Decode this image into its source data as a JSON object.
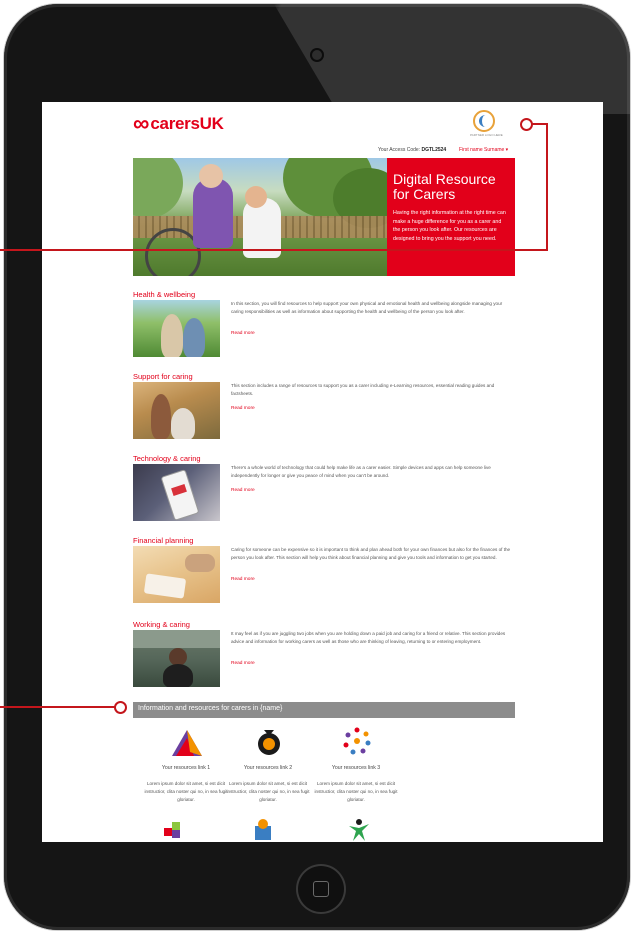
{
  "header": {
    "logo_mark": "➰",
    "logo_carers": "carers",
    "logo_uk": "UK",
    "partner_caption": "PARTNER LOGO HERE",
    "access_label": "Your Access Code:",
    "access_code": "DGTL2524",
    "user_menu": "First name Surname ▾"
  },
  "hero": {
    "title": "Digital Resource for Carers",
    "text": "Having the right information at the right time can make a huge difference for you as a carer and the person you look after. Our resources are designed to bring you the support you need."
  },
  "sections": [
    {
      "title": "Health & wellbeing",
      "desc": "In this section, you will find resources to help support your own physical and emotional health and wellbeing alongside managing your caring responsibilities as well as information about supporting the health and wellbeing of the person you look after.",
      "link": "Read more"
    },
    {
      "title": "Support for caring",
      "desc": "This section includes a range of resources to support you as a carer including e-Learning resources, essential reading guides and factsheets.",
      "link": "Read more"
    },
    {
      "title": "Technology & caring",
      "desc": "There's a whole world of technology that could help make life as a carer easier. Simple devices and apps can help someone live independently for longer or give you peace of mind when you can't be around.",
      "link": "Read more"
    },
    {
      "title": "Financial planning",
      "desc": "Caring for someone can be expensive so it is important to think and plan ahead both for your own finances but also for the finances of the person you look after. This section will help you think about financial planning and give you tools and information to get you started.",
      "link": "Read more"
    },
    {
      "title": "Working & caring",
      "desc": "It may feel as if you are juggling two jobs when you are holding down a paid job and caring for a friend or relative. This section provides advice and information for working carers as well as those who are thinking of leaving, returning to or entering employment.",
      "link": "Read more"
    }
  ],
  "resources": {
    "title": "Information and resources for carers in {name}",
    "items": [
      {
        "label": "Your resources link 1",
        "desc": "Lorem ipsum dolor sit amet, si est dicit instructior, clita noster qui no, in sea fugit gloriatur."
      },
      {
        "label": "Your resources link 2",
        "desc": "Lorem ipsum dolor sit amet, si est dicit instructior, clita noster qui no, in sea fugit gloriatur."
      },
      {
        "label": "Your resources link 3",
        "desc": "Lorem ipsum dolor sit amet, si est dicit instructior, clita noster qui no, in sea fugit gloriatur."
      }
    ]
  },
  "colors": {
    "brand_red": "#e2001a",
    "callout_red": "#c4161c",
    "resources_bar": "#8c8c8c"
  }
}
